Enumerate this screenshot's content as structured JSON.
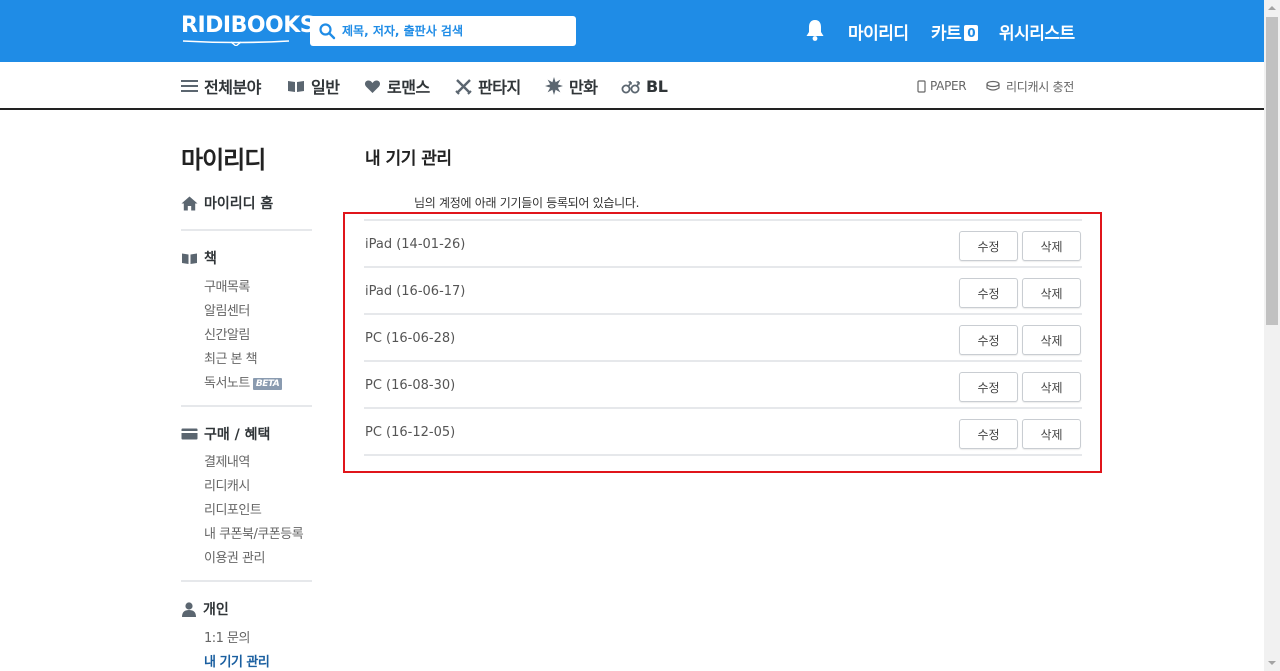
{
  "header": {
    "logo_text": "RIDIBOOKS",
    "search_placeholder": "제목, 저자, 출판사 검색",
    "nav": {
      "myridi": "마이리디",
      "cart": "카트",
      "cart_count": "0",
      "wishlist": "위시리스트"
    },
    "brand_color": "#1f8ce6"
  },
  "categories": {
    "all": "전체분야",
    "general": "일반",
    "romance": "로맨스",
    "fantasy": "판타지",
    "comics": "만화",
    "bl": "BL",
    "paper": "PAPER",
    "cash_charge": "리디캐시 충전"
  },
  "sidebar": {
    "title": "마이리디",
    "home": "마이리디 홈",
    "books": {
      "heading": "책",
      "items": [
        "구매목록",
        "알림센터",
        "신간알림",
        "최근 본 책",
        "독서노트"
      ],
      "beta_badge": "BETA"
    },
    "purchase": {
      "heading": "구매 / 혜택",
      "items": [
        "결제내역",
        "리디캐시",
        "리디포인트",
        "내 쿠폰북/쿠폰등록",
        "이용권 관리"
      ]
    },
    "personal": {
      "heading": "개인",
      "items": [
        "1:1 문의",
        "내 기기 관리"
      ]
    }
  },
  "main": {
    "title": "내 기기 관리",
    "account_note": "님의 계정에 아래 기기들이 등록되어 있습니다.",
    "edit_label": "수정",
    "delete_label": "삭제",
    "devices": [
      "iPad (14-01-26)",
      "iPad (16-06-17)",
      "PC (16-06-28)",
      "PC (16-08-30)",
      "PC (16-12-05)"
    ],
    "highlight_color": "#e0151b"
  }
}
